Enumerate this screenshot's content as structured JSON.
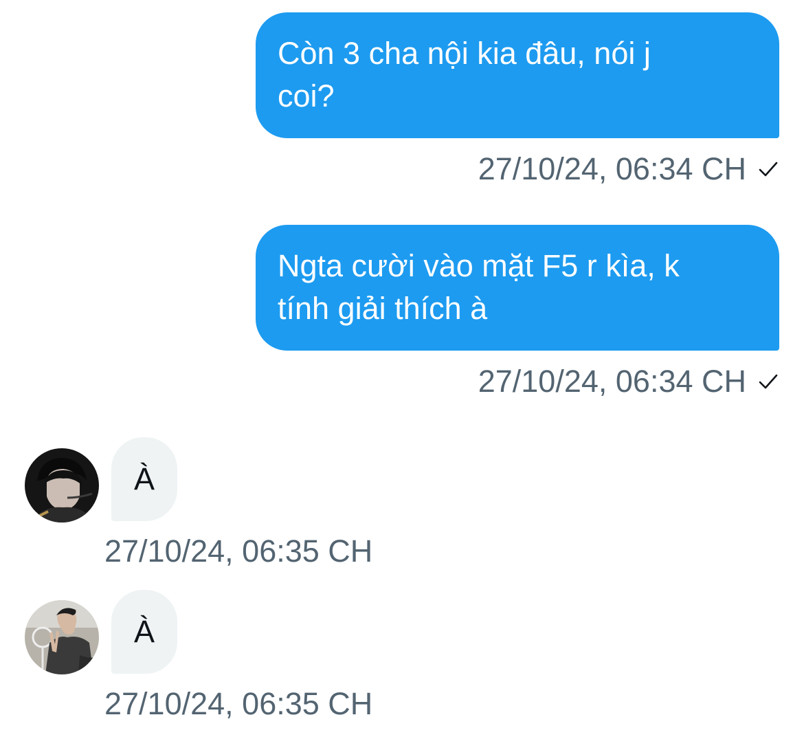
{
  "colors": {
    "outgoing_bubble": "#1d9bf0",
    "incoming_bubble": "#eff3f4",
    "timestamp_text": "#536471",
    "message_text_in": "#0f1419"
  },
  "messages": [
    {
      "direction": "outgoing",
      "text_lines": [
        "Còn 3 cha nội kia đâu, nói j",
        "coi?"
      ],
      "timestamp": "27/10/24, 06:34 CH",
      "status_icon": "checkmark-icon"
    },
    {
      "direction": "outgoing",
      "text_lines": [
        "Ngta cười vào mặt F5 r kìa, k",
        "tính giải thích à"
      ],
      "timestamp": "27/10/24, 06:34 CH",
      "status_icon": "checkmark-icon"
    },
    {
      "direction": "incoming",
      "avatar": "avatar-dark-hair-headset",
      "text": "À",
      "timestamp": "27/10/24, 06:35 CH"
    },
    {
      "direction": "incoming",
      "avatar": "avatar-peace-sign",
      "text": "À",
      "timestamp": "27/10/24, 06:35 CH"
    }
  ]
}
